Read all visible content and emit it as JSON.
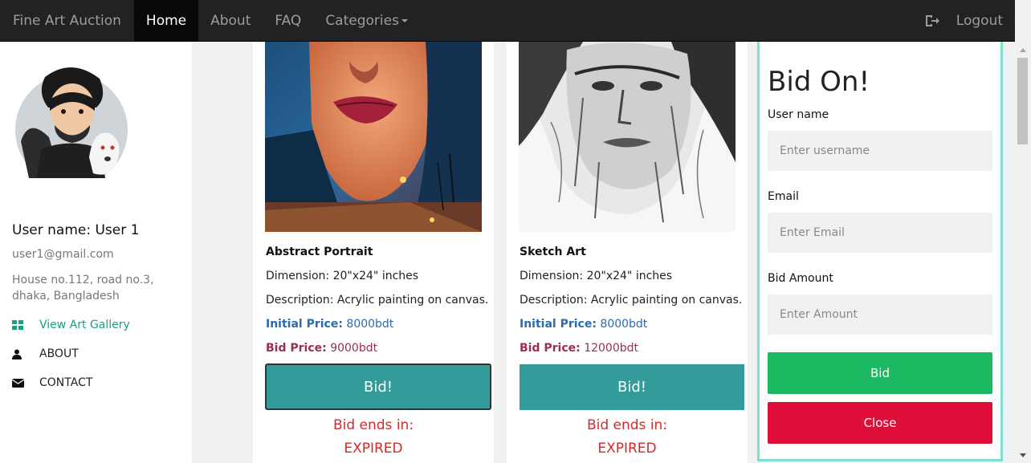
{
  "navbar": {
    "brand": "Fine Art Auction",
    "items": [
      {
        "label": "Home",
        "active": true
      },
      {
        "label": "About"
      },
      {
        "label": "FAQ"
      },
      {
        "label": "Categories"
      }
    ],
    "logout_label": "Logout"
  },
  "profile": {
    "username": "User name: User 1",
    "email": "user1@gmail.com",
    "address": "House no.112, road no.3, dhaka, Bangladesh",
    "links": [
      {
        "label": "View Art Gallery",
        "icon": "grid-icon"
      },
      {
        "label": "ABOUT",
        "icon": "user-icon"
      },
      {
        "label": "CONTACT",
        "icon": "envelope-icon"
      }
    ]
  },
  "cards": [
    {
      "title": "Abstract Portrait",
      "dimension": "Dimension: 20\"x24\" inches",
      "description": "Description: Acrylic painting on canvas.",
      "initial_label": "Initial Price:",
      "initial_value": "8000bdt",
      "bid_label": "Bid Price:",
      "bid_value": "9000bdt",
      "button": "Bid!",
      "ends_label": "Bid ends in:",
      "status": "EXPIRED"
    },
    {
      "title": "Sketch Art",
      "dimension": "Dimension: 20\"x24\" inches",
      "description": "Description: Acrylic painting on canvas.",
      "initial_label": "Initial Price:",
      "initial_value": "8000bdt",
      "bid_label": "Bid Price:",
      "bid_value": "12000bdt",
      "button": "Bid!",
      "ends_label": "Bid ends in:",
      "status": "EXPIRED"
    }
  ],
  "bid_modal": {
    "title": "Bid On!",
    "username_label": "User name",
    "username_placeholder": "Enter username",
    "email_label": "Email",
    "email_placeholder": "Enter Email",
    "amount_label": "Bid Amount",
    "amount_placeholder": "Enter Amount",
    "bid_button": "Bid",
    "close_button": "Close"
  },
  "colors": {
    "navbar_bg": "#222222",
    "bid_button": "#339b99",
    "modal_bid": "#1cb862",
    "modal_close": "#de1039",
    "expired_text": "#d22b2b",
    "modal_border": "#7fe0d1",
    "gallery_link": "#16a085"
  }
}
